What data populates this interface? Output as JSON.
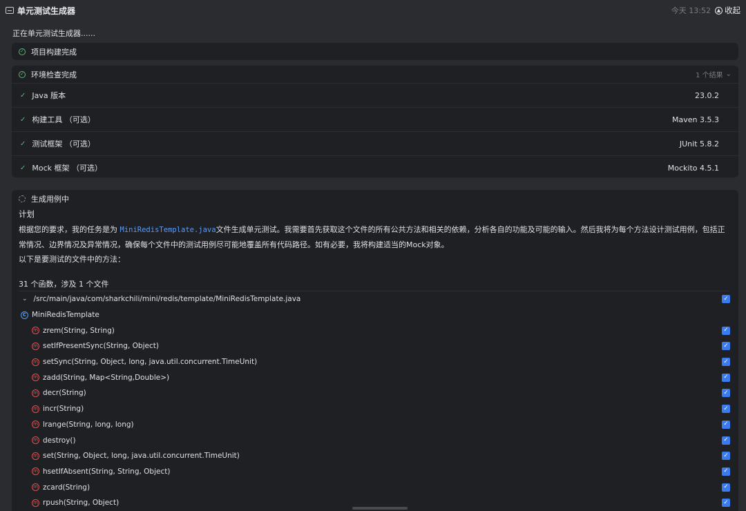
{
  "header": {
    "title": "单元测试生成器",
    "time": "今天 13:52",
    "collapse_label": "收起"
  },
  "status_text": "正在单元测试生成器......",
  "project_build": {
    "label": "项目构建完成"
  },
  "env_check": {
    "label": "环境检查完成",
    "result_count": "1 个结果",
    "items": [
      {
        "label": "Java 版本",
        "value": "23.0.2"
      },
      {
        "label": "构建工具 （可选）",
        "value": "Maven 3.5.3"
      },
      {
        "label": "测试框架 （可选）",
        "value": "JUnit 5.8.2"
      },
      {
        "label": "Mock 框架 （可选）",
        "value": "Mockito 4.5.1"
      }
    ]
  },
  "generation": {
    "label": "生成用例中",
    "plan_heading": "计划",
    "plan_text_before": "根据您的要求，我的任务是为 ",
    "plan_code": "MiniRedisTemplate.java",
    "plan_text_after": "文件生成单元测试。我需要首先获取这个文件的所有公共方法和相关的依赖，分析各自的功能及可能的输入。然后我将为每个方法设计测试用例，包括正常情况、边界情况及异常情况，确保每个文件中的测试用例尽可能地覆盖所有代码路径。如有必要，我将构建适当的Mock对象。",
    "methods_intro": "以下是要测试的文件中的方法：",
    "fn_count": "31 个函数，涉及 1 个文件",
    "file_path": "/src/main/java/com/sharkchili/mini/redis/template/MiniRedisTemplate.java",
    "class_name": "MiniRedisTemplate",
    "methods": [
      "zrem(String, String)",
      "setIfPresentSync(String, Object)",
      "setSync(String, Object, long, java.util.concurrent.TimeUnit)",
      "zadd(String, Map<String,Double>)",
      "decr(String)",
      "incr(String)",
      "lrange(String, long, long)",
      "destroy()",
      "set(String, Object, long, java.util.concurrent.TimeUnit)",
      "hsetIfAbsent(String, String, Object)",
      "zcard(String)",
      "rpush(String, Object)"
    ]
  },
  "colors": {
    "success": "#5fb57a",
    "accent": "#3a7bf0",
    "method_icon": "#e05252",
    "class_icon": "#5c9cf5"
  }
}
